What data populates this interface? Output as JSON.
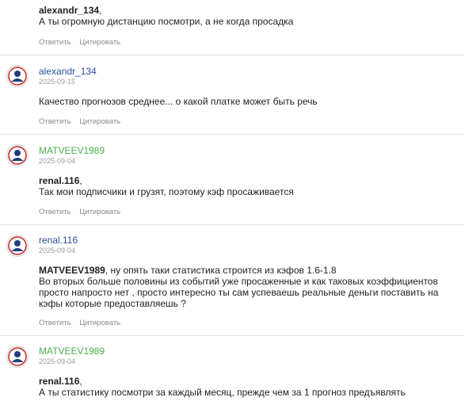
{
  "actions": {
    "reply": "Ответить",
    "quote": "Цитировать"
  },
  "comments": [
    {
      "quote_author": "alexandr_134",
      "text": "А ты огромную дистанцию посмотри, а не когда просадка"
    },
    {
      "author": "alexandr_134",
      "date": "2025-09-15",
      "text": "Качество прогнозов среднее... о какой платке может быть речь"
    },
    {
      "author": "MATVEEV1989",
      "date": "2025-09-04",
      "quote_author": "renal.116",
      "text": "Так мои подписчики и грузят, поэтому кэф просаживается"
    },
    {
      "author": "renal.116",
      "date": "2025-09-04",
      "quote_author": "MATVEEV1989",
      "text_first": ", ну опять таки статистика строится из кэфов 1.6-1.8",
      "text_rest": "Во вторых больше половины из событий уже просаженные и как таковых коэффициентов просто напросто нет , просто интересно ты сам успеваешь реальные деньги поставить на кэфы которые предоставляешь ?"
    },
    {
      "author": "MATVEEV1989",
      "date": "2025-09-04",
      "quote_author": "renal.116",
      "text": "А ты статистику посмотри за каждый месяц, прежде чем за 1 прогноз предъявлять"
    }
  ],
  "colors": {
    "link_blue": "#2a4f9c",
    "author_green": "#4caf50",
    "muted": "#8a8a8a"
  }
}
